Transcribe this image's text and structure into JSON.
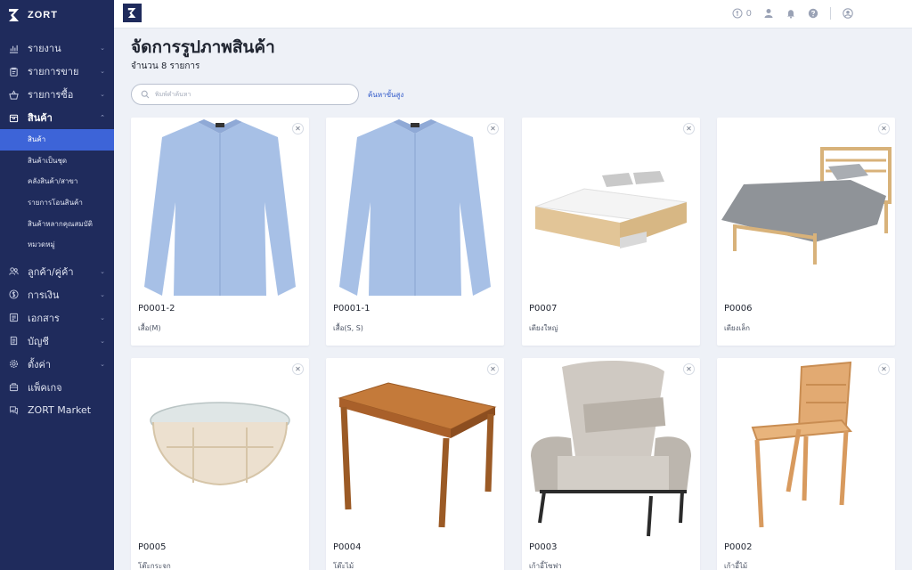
{
  "brand": {
    "name": "ZORT"
  },
  "sidebar": {
    "items": [
      {
        "label": "รายงาน",
        "icon": "chart-icon"
      },
      {
        "label": "รายการขาย",
        "icon": "clipboard-icon"
      },
      {
        "label": "รายการซื้อ",
        "icon": "basket-icon"
      },
      {
        "label": "สินค้า",
        "icon": "box-icon"
      },
      {
        "label": "ลูกค้า/คู่ค้า",
        "icon": "people-icon"
      },
      {
        "label": "การเงิน",
        "icon": "dollar-icon"
      },
      {
        "label": "เอกสาร",
        "icon": "document-icon"
      },
      {
        "label": "บัญชี",
        "icon": "ledger-icon"
      },
      {
        "label": "ตั้งค่า",
        "icon": "gear-icon"
      },
      {
        "label": "แพ็คเกจ",
        "icon": "package-icon"
      },
      {
        "label": "ZORT Market",
        "icon": "chat-icon"
      }
    ],
    "sub_items": [
      {
        "label": "สินค้า"
      },
      {
        "label": "สินค้าเป็นชุด"
      },
      {
        "label": "คลังสินค้า/สาขา"
      },
      {
        "label": "รายการโอนสินค้า"
      },
      {
        "label": "สินค้าหลากคุณสมบัติ"
      },
      {
        "label": "หมวดหมู่"
      }
    ]
  },
  "topbar": {
    "notification_count": "0",
    "icons": [
      "coin-icon",
      "user-icon",
      "bell-icon",
      "help-icon",
      "account-icon"
    ]
  },
  "main": {
    "title": "จัดการรูปภาพสินค้า",
    "subtitle": "จำนวน 8 รายการ",
    "search_placeholder": "พิมพ์คำค้นหา",
    "advanced_search": "ค้นหาขั้นสูง",
    "products": [
      {
        "code": "P0001-2",
        "name": "เสื้อ(M)",
        "image": "shirt"
      },
      {
        "code": "P0001-1",
        "name": "เสื้อ(S, S)",
        "image": "shirt"
      },
      {
        "code": "P0007",
        "name": "เตียงใหญ่",
        "image": "bed-large"
      },
      {
        "code": "P0006",
        "name": "เตียงเล็ก",
        "image": "bed-small"
      },
      {
        "code": "P0005",
        "name": "โต๊ะกระจก",
        "image": "glass-table"
      },
      {
        "code": "P0004",
        "name": "โต๊ะไม้",
        "image": "wood-table"
      },
      {
        "code": "P0003",
        "name": "เก้าอี้โซฟา",
        "image": "sofa-chair"
      },
      {
        "code": "P0002",
        "name": "เก้าอี้ไม้",
        "image": "wood-chair"
      }
    ]
  },
  "colors": {
    "sidebar_bg": "#1f2b5c",
    "accent": "#3d64d8",
    "page_bg": "#eef1f7"
  }
}
